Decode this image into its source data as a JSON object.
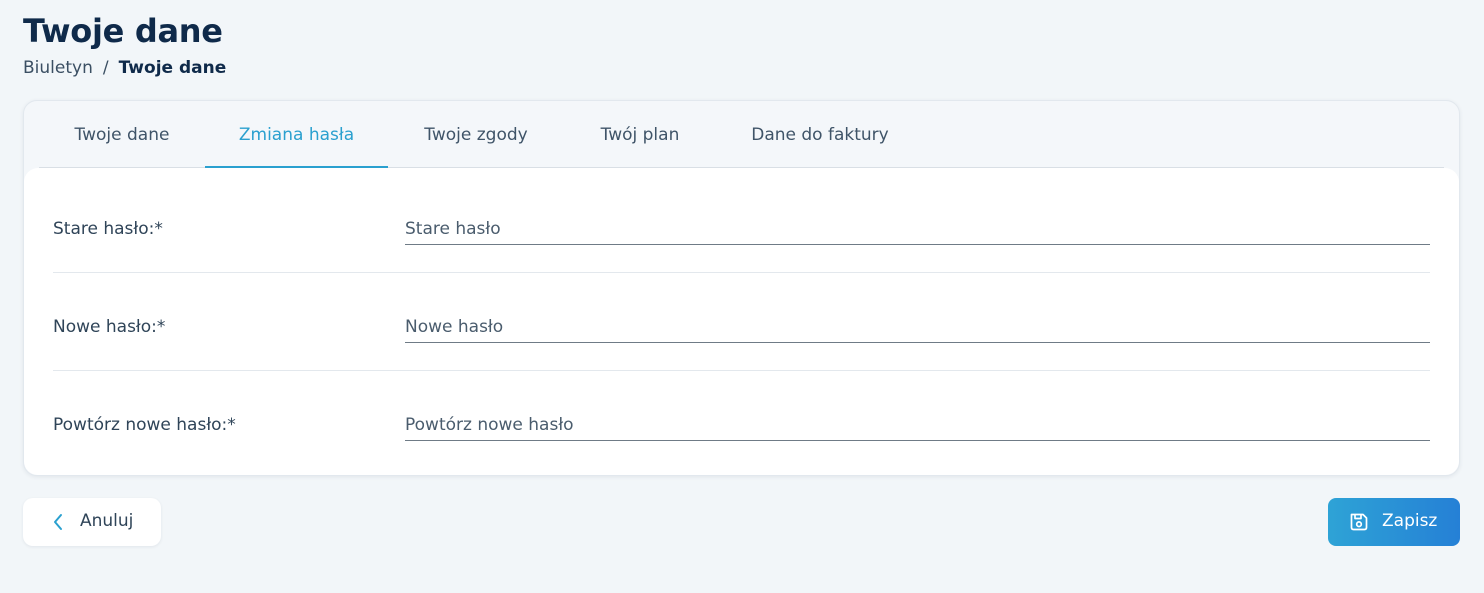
{
  "header": {
    "title": "Twoje dane",
    "breadcrumb": {
      "link": "Biuletyn",
      "separator": "/",
      "current": "Twoje dane"
    }
  },
  "tabs": [
    {
      "label": "Twoje dane",
      "active": false
    },
    {
      "label": "Zmiana hasła",
      "active": true
    },
    {
      "label": "Twoje zgody",
      "active": false
    },
    {
      "label": "Twój plan",
      "active": false
    },
    {
      "label": "Dane do faktury",
      "active": false
    }
  ],
  "form": {
    "fields": [
      {
        "label": "Stare hasło:*",
        "placeholder": "Stare hasło",
        "value": ""
      },
      {
        "label": "Nowe hasło:*",
        "placeholder": "Nowe hasło",
        "value": ""
      },
      {
        "label": "Powtórz nowe hasło:*",
        "placeholder": "Powtórz nowe hasło",
        "value": ""
      }
    ]
  },
  "actions": {
    "cancel_label": "Anuluj",
    "save_label": "Zapisz"
  },
  "colors": {
    "accent": "#2aa0cf",
    "title": "#0f2a4a",
    "save_gradient_start": "#2ea3d6",
    "save_gradient_end": "#2580d6"
  },
  "icons": {
    "cancel": "chevron-left-icon",
    "save": "floppy-disk-icon"
  }
}
